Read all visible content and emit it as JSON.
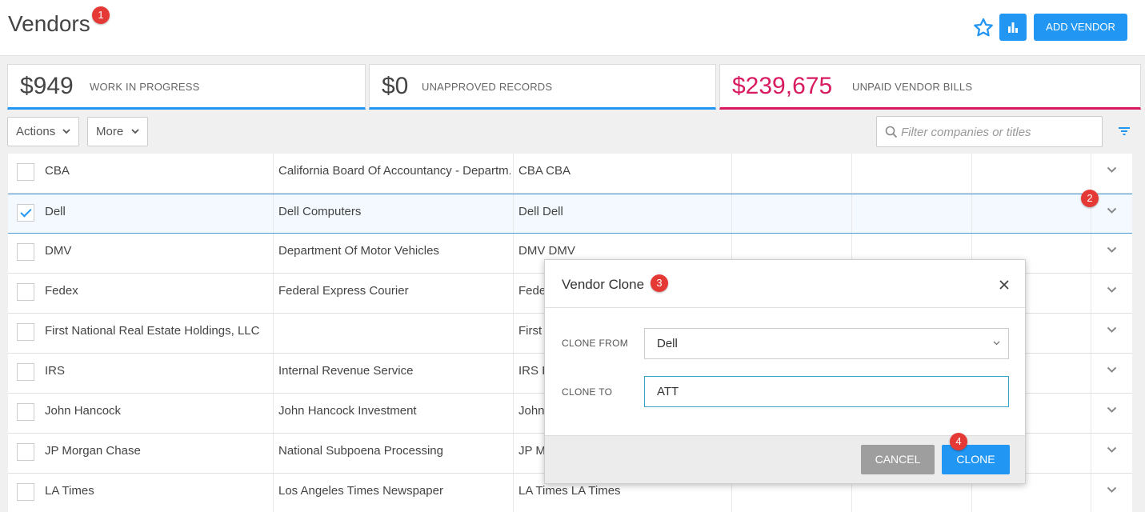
{
  "header": {
    "title": "Vendors",
    "step_badge": "1",
    "star_icon": "star-outline-icon",
    "chart_icon": "bar-chart-icon",
    "add_button": "ADD VENDOR",
    "accent": "#2196f3"
  },
  "stats": [
    {
      "value": "$949",
      "label": "WORK IN PROGRESS"
    },
    {
      "value": "$0",
      "label": "UNAPPROVED RECORDS"
    },
    {
      "value": "$239,675",
      "label": "UNPAID VENDOR BILLS",
      "color": "#d81b60"
    }
  ],
  "toolbar": {
    "actions_label": "Actions",
    "more_label": "More",
    "filter_placeholder": "Filter companies or titles"
  },
  "rows": [
    {
      "name": "CBA",
      "company": "California Board Of Accountancy - Departm...",
      "title": "CBA CBA",
      "checked": false
    },
    {
      "name": "Dell",
      "company": "Dell Computers",
      "title": "Dell Dell",
      "checked": true,
      "badge": "2"
    },
    {
      "name": "DMV",
      "company": "Department Of Motor Vehicles",
      "title": "DMV DMV",
      "checked": false
    },
    {
      "name": "Fedex",
      "company": "Federal Express Courier",
      "title": "Fede",
      "checked": false
    },
    {
      "name": "First National Real Estate Holdings, LLC",
      "company": "",
      "title": "First",
      "checked": false
    },
    {
      "name": "IRS",
      "company": "Internal Revenue Service",
      "title": "IRS II",
      "checked": false
    },
    {
      "name": "John Hancock",
      "company": "John Hancock Investment",
      "title": "John",
      "checked": false
    },
    {
      "name": "JP Morgan Chase",
      "company": "National Subpoena Processing",
      "title": "JP M",
      "checked": false
    },
    {
      "name": "LA Times",
      "company": "Los Angeles Times Newspaper",
      "title": "LA Times LA Times",
      "checked": false
    }
  ],
  "modal": {
    "title": "Vendor Clone",
    "title_badge": "3",
    "clone_from_label": "CLONE FROM",
    "clone_from_value": "Dell",
    "clone_to_label": "CLONE TO",
    "clone_to_value": "ATT",
    "cancel_label": "CANCEL",
    "clone_label": "CLONE",
    "clone_badge": "4"
  }
}
